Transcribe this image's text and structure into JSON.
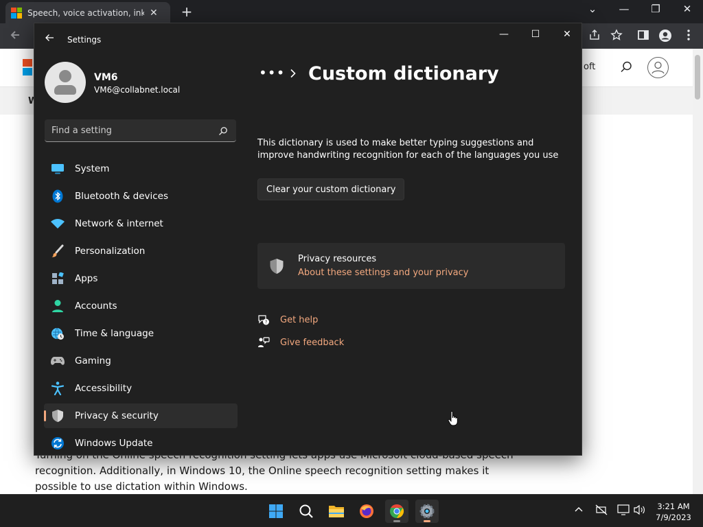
{
  "browser": {
    "tab_title": "Speech, voice activation, inking, t",
    "tab_close": "✕",
    "new_tab": "+",
    "window_controls": [
      "⌄",
      "—",
      "❐",
      "✕"
    ],
    "toolbar": {
      "back_icon": "arrow-left-icon",
      "share_icon": "share-icon",
      "bookmark_icon": "star-icon",
      "sidepanel_icon": "side-panel-icon",
      "profile_icon": "profile-icon",
      "menu_icon": "kebab-menu-icon"
    }
  },
  "site": {
    "header_text": "oft",
    "subnav_letter": "W",
    "article_lines": [
      "Turning on the Online speech recognition setting lets apps use Microsoft cloud-based speech",
      "recognition. Additionally, in Windows 10, the Online speech recognition setting makes it",
      "possible to use dictation within Windows."
    ]
  },
  "settings": {
    "window_title": "Settings",
    "window_controls": [
      "—",
      "☐",
      "✕"
    ],
    "user": {
      "name": "VM6",
      "email": "VM6@collabnet.local"
    },
    "search": {
      "placeholder": "Find a setting"
    },
    "nav": [
      {
        "id": "system",
        "label": "System",
        "icon": "monitor-icon",
        "color": "#4cc2ff"
      },
      {
        "id": "bluetooth",
        "label": "Bluetooth & devices",
        "icon": "bluetooth-icon",
        "color": "#0078d4"
      },
      {
        "id": "network",
        "label": "Network & internet",
        "icon": "wifi-icon",
        "color": "#4cc2ff"
      },
      {
        "id": "personalization",
        "label": "Personalization",
        "icon": "paintbrush-icon",
        "color": "#f7a35c"
      },
      {
        "id": "apps",
        "label": "Apps",
        "icon": "apps-icon",
        "color": "#9fb3c8"
      },
      {
        "id": "accounts",
        "label": "Accounts",
        "icon": "person-icon",
        "color": "#2fd5a3"
      },
      {
        "id": "time-language",
        "label": "Time & language",
        "icon": "globe-clock-icon",
        "color": "#4cc2ff"
      },
      {
        "id": "gaming",
        "label": "Gaming",
        "icon": "gamepad-icon",
        "color": "#b7b7b7"
      },
      {
        "id": "accessibility",
        "label": "Accessibility",
        "icon": "accessibility-icon",
        "color": "#4cc2ff"
      },
      {
        "id": "privacy-security",
        "label": "Privacy & security",
        "icon": "shield-icon",
        "color": "#a9a9a9",
        "selected": true
      },
      {
        "id": "windows-update",
        "label": "Windows Update",
        "icon": "update-icon",
        "color": "#0078d4"
      }
    ],
    "breadcrumb": {
      "dots": "•••",
      "title": "Custom dictionary"
    },
    "description": "This dictionary is used to make better typing suggestions and improve handwriting recognition for each of the languages you use",
    "clear_button": "Clear your custom dictionary",
    "privacy_card": {
      "title": "Privacy resources",
      "link": "About these settings and your privacy"
    },
    "help_links": [
      {
        "label": "Get help",
        "icon": "help-chat-icon"
      },
      {
        "label": "Give feedback",
        "icon": "feedback-icon"
      }
    ],
    "accent_color": "#f4a97f"
  },
  "taskbar": {
    "apps": [
      "windows-start-icon",
      "search-icon",
      "file-explorer-icon",
      "firefox-icon",
      "chrome-icon",
      "settings-gear-icon"
    ],
    "tray": [
      "chevron-up-icon",
      "network-off-icon",
      "display-icon",
      "speaker-icon"
    ],
    "time": "3:21 AM",
    "date": "7/9/2023"
  }
}
